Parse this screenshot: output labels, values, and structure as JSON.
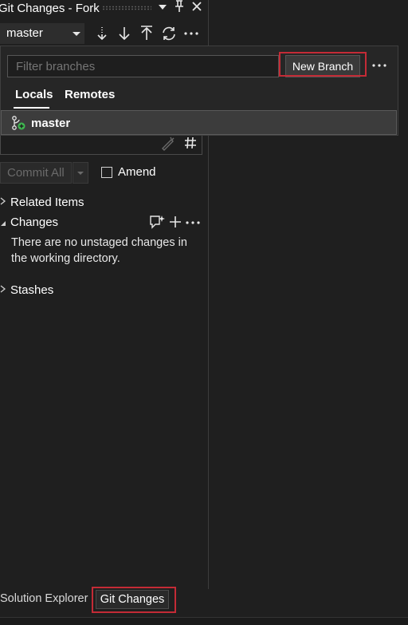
{
  "panel": {
    "title": "Git Changes - Fork",
    "title_icons": [
      "dropdown-caret-icon",
      "pin-icon",
      "close-icon"
    ]
  },
  "toolbar": {
    "branch_value": "master",
    "icons": [
      "fetch-icon",
      "pull-icon",
      "push-icon",
      "sync-icon",
      "more-options-icon"
    ]
  },
  "branch_dropdown": {
    "filter_placeholder": "Filter branches",
    "new_branch_label": "New Branch",
    "tabs": [
      {
        "label": "Locals",
        "selected": true
      },
      {
        "label": "Remotes",
        "selected": false
      }
    ],
    "branches": [
      {
        "name": "master",
        "icon": "branch-icon"
      }
    ]
  },
  "commit": {
    "commit_all_label": "Commit All",
    "amend_label": "Amend",
    "amend_checked": false
  },
  "sections": {
    "related_items": "Related Items",
    "changes": "Changes",
    "changes_empty_message": "There are no unstaged changes in the working directory.",
    "stashes": "Stashes"
  },
  "bottom_tabs": {
    "solution_explorer": "Solution Explorer",
    "git_changes": "Git Changes"
  },
  "colors": {
    "background": "#1f1f1f",
    "highlight_box": "#c42b36",
    "branch_icon_accent": "#3fb950"
  }
}
